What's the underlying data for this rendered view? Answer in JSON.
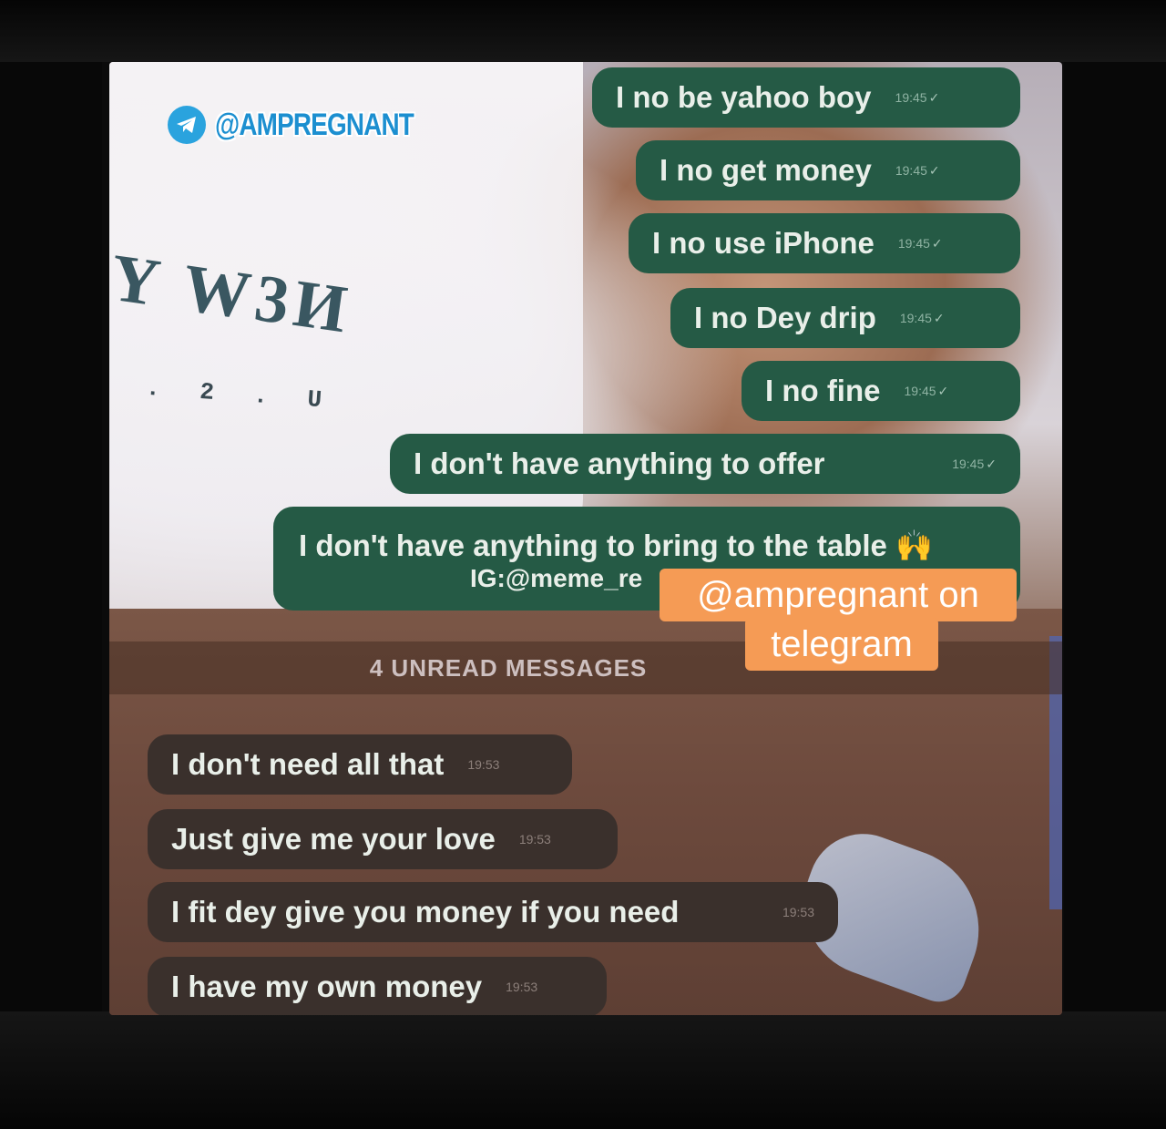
{
  "watermark": {
    "icon": "telegram-icon",
    "handle": "@AMPREGNANT"
  },
  "shirt": {
    "print": "Y W3И",
    "sub": ". 2 . U"
  },
  "outgoing_messages": [
    {
      "text": "I no be yahoo boy",
      "time": "19:45"
    },
    {
      "text": "I no get money",
      "time": "19:45"
    },
    {
      "text": "I no use iPhone",
      "time": "19:45"
    },
    {
      "text": "I no Dey drip",
      "time": "19:45"
    },
    {
      "text": "I no fine",
      "time": "19:45"
    },
    {
      "text": "I don't have anything to offer",
      "time": "19:45"
    },
    {
      "text": "I don't have anything to bring to the table 🙌",
      "caption": "IG:@meme_re"
    }
  ],
  "unread_label": "4 UNREAD MESSAGES",
  "incoming_messages": [
    {
      "text": "I don't need all that",
      "time": "19:53"
    },
    {
      "text": "Just give me your love",
      "time": "19:53"
    },
    {
      "text": "I fit dey give you money if you need",
      "time": "19:53"
    },
    {
      "text": "I have my own money",
      "time": "19:53"
    }
  ],
  "overlay": {
    "line1": "@ampregnant on",
    "line2": "telegram"
  },
  "colors": {
    "outgoing_bubble": "#255a45",
    "incoming_bubble": "#3a302c",
    "overlay": "#f59b55",
    "telegram_blue": "#2aa3de"
  }
}
